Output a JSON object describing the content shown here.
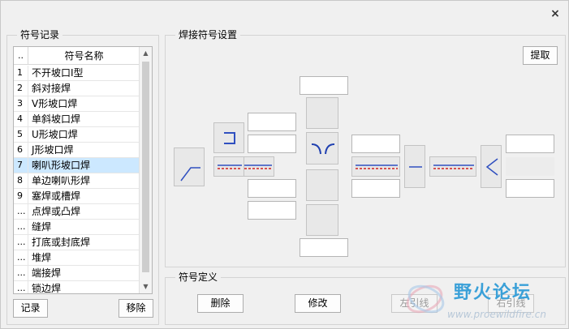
{
  "window": {
    "close_label": "×"
  },
  "left_panel": {
    "title": "符号记录",
    "header_index": "..",
    "header_name": "符号名称",
    "rows": [
      {
        "idx": "1",
        "name": "不开坡口I型"
      },
      {
        "idx": "2",
        "name": "斜对接焊"
      },
      {
        "idx": "3",
        "name": "V形坡口焊"
      },
      {
        "idx": "4",
        "name": "单斜坡口焊"
      },
      {
        "idx": "5",
        "name": "U形坡口焊"
      },
      {
        "idx": "6",
        "name": "J形坡口焊"
      },
      {
        "idx": "7",
        "name": "喇叭形坡口焊",
        "selected": true
      },
      {
        "idx": "8",
        "name": "单边喇叭形焊"
      },
      {
        "idx": "9",
        "name": "塞焊或槽焊"
      },
      {
        "idx": "...",
        "name": "点焊或凸焊"
      },
      {
        "idx": "...",
        "name": "缝焊"
      },
      {
        "idx": "...",
        "name": "打底或封底焊"
      },
      {
        "idx": "...",
        "name": "堆焊"
      },
      {
        "idx": "...",
        "name": "端接焊"
      },
      {
        "idx": "...",
        "name": "锁边焊"
      }
    ],
    "record_button": "记录",
    "remove_button": "移除"
  },
  "settings_panel": {
    "title": "焊接符号设置",
    "extract_button": "提取"
  },
  "definition_panel": {
    "title": "符号定义",
    "delete_button": "删除",
    "modify_button": "修改",
    "left_leader_button": "左引线",
    "right_leader_button": "右引线"
  },
  "watermark": {
    "text": "野火论坛",
    "url": "www.proewildfire.cn"
  },
  "colors": {
    "line_blue": "#3050c0",
    "line_red": "#d02020",
    "selection": "#cce8ff"
  }
}
